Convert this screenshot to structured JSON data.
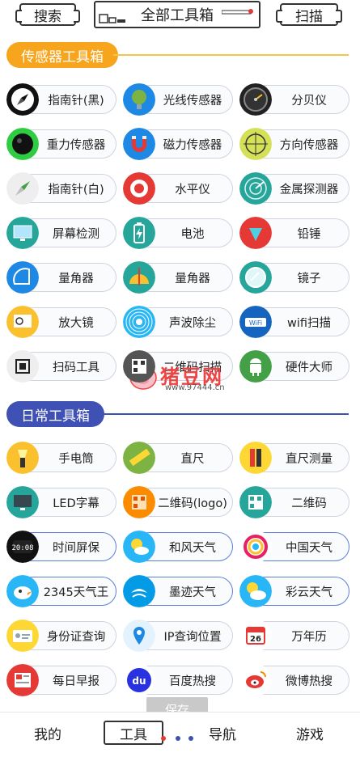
{
  "topbar": {
    "search_label": "搜索",
    "title": "全部工具箱",
    "scan_label": "扫描"
  },
  "sections": {
    "sensor": {
      "title": "传感器工具箱",
      "color": "#f7a51c"
    },
    "daily": {
      "title": "日常工具箱",
      "color": "#3f51b5"
    }
  },
  "sensor_tools": [
    {
      "label": "指南针(黑)",
      "icon": "compass-black-icon"
    },
    {
      "label": "光线传感器",
      "icon": "light-sensor-icon"
    },
    {
      "label": "分贝仪",
      "icon": "decibel-meter-icon"
    },
    {
      "label": "重力传感器",
      "icon": "gravity-sensor-icon"
    },
    {
      "label": "磁力传感器",
      "icon": "magnet-icon"
    },
    {
      "label": "方向传感器",
      "icon": "crosshair-icon"
    },
    {
      "label": "指南针(白)",
      "icon": "compass-white-icon"
    },
    {
      "label": "水平仪",
      "icon": "target-level-icon"
    },
    {
      "label": "金属探测器",
      "icon": "radar-icon"
    },
    {
      "label": "屏幕检测",
      "icon": "monitor-icon"
    },
    {
      "label": "电池",
      "icon": "battery-icon"
    },
    {
      "label": "铅锤",
      "icon": "plumb-icon"
    },
    {
      "label": "量角器",
      "icon": "protractor-icon"
    },
    {
      "label": "量角器",
      "icon": "protractor-2-icon"
    },
    {
      "label": "镜子",
      "icon": "mirror-icon"
    },
    {
      "label": "放大镜",
      "icon": "magnifier-icon"
    },
    {
      "label": "声波除尘",
      "icon": "sound-wave-icon"
    },
    {
      "label": "wifi扫描",
      "icon": "wifi-icon"
    },
    {
      "label": "扫码工具",
      "icon": "qr-scan-icon"
    },
    {
      "label": "二维码扫描",
      "icon": "qr-code-icon"
    },
    {
      "label": "硬件大师",
      "icon": "android-icon"
    }
  ],
  "daily_tools": [
    {
      "label": "手电筒",
      "icon": "flashlight-icon"
    },
    {
      "label": "直尺",
      "icon": "ruler-icon"
    },
    {
      "label": "直尺测量",
      "icon": "ruler-measure-icon"
    },
    {
      "label": "LED字幕",
      "icon": "led-screen-icon"
    },
    {
      "label": "二维码(logo)",
      "icon": "qr-logo-icon"
    },
    {
      "label": "二维码",
      "icon": "qr-icon"
    },
    {
      "label": "时间屏保",
      "icon": "clock-icon"
    },
    {
      "label": "和风天气",
      "icon": "weather-sun-icon"
    },
    {
      "label": "中国天气",
      "icon": "china-weather-icon"
    },
    {
      "label": "2345天气王",
      "icon": "bird-weather-icon"
    },
    {
      "label": "墨迹天气",
      "icon": "moji-weather-icon"
    },
    {
      "label": "彩云天气",
      "icon": "caiyun-weather-icon"
    },
    {
      "label": "身份证查询",
      "icon": "id-card-icon"
    },
    {
      "label": "IP查询位置",
      "icon": "location-pin-icon"
    },
    {
      "label": "万年历",
      "icon": "calendar-icon"
    },
    {
      "label": "每日早报",
      "icon": "newspaper-icon"
    },
    {
      "label": "百度热搜",
      "icon": "baidu-icon"
    },
    {
      "label": "微博热搜",
      "icon": "weibo-icon"
    }
  ],
  "calendar_day": "26",
  "clock_time": "20:08",
  "save_toast": "保存",
  "watermark": {
    "text": "猪豆网",
    "url": "www.97444.cn"
  },
  "bottom_nav": {
    "me": "我的",
    "tools": "工具",
    "nav": "导航",
    "games": "游戏"
  }
}
